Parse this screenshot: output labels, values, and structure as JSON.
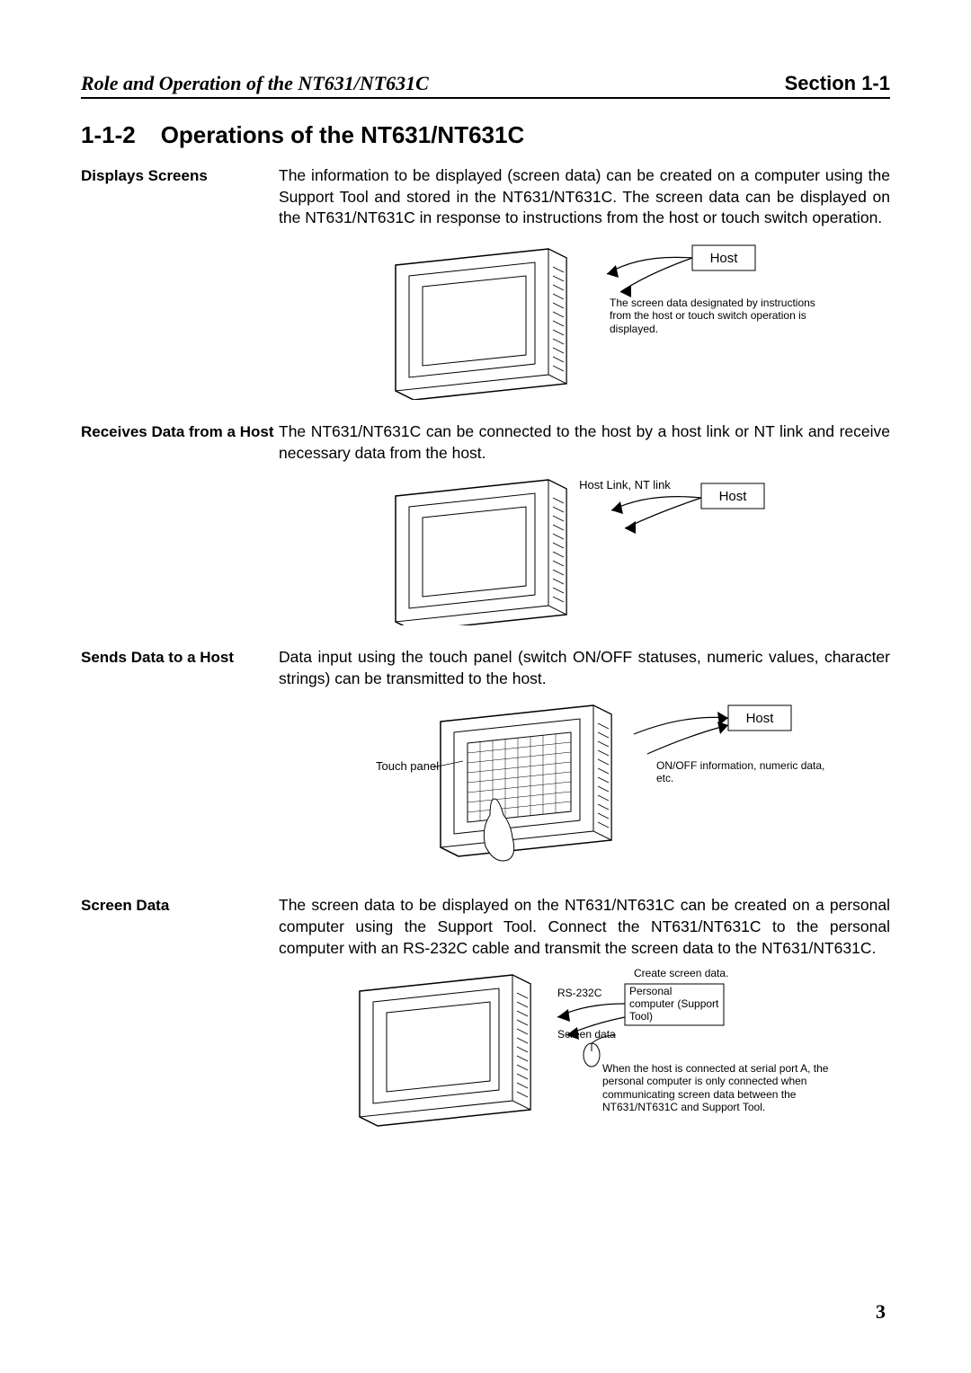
{
  "header": {
    "left": "Role and Operation of the NT631/NT631C",
    "right": "Section 1-1"
  },
  "section": {
    "number": "1-1-2",
    "title": "Operations of the NT631/NT631C"
  },
  "entries": [
    {
      "label": "Displays Screens",
      "body": "The information to be displayed (screen data) can be created on a computer using the Support Tool and stored in the NT631/NT631C. The screen data can be displayed on the NT631/NT631C in response to instructions from the host or touch switch operation.",
      "figure": {
        "hostLabel": "Host",
        "note": "The screen data designated by instructions from the host or touch switch operation is displayed."
      }
    },
    {
      "label": "Receives Data from a Host",
      "body": "The NT631/NT631C can be connected to the host by a host link or NT link and receive necessary data from the host.",
      "figure": {
        "linkLabel": "Host Link, NT link",
        "hostLabel": "Host"
      }
    },
    {
      "label": "Sends Data to a Host",
      "body": "Data input using the touch panel (switch ON/OFF statuses, numeric values, character strings) can be transmitted to the host.",
      "figure": {
        "touchLabel": "Touch panel",
        "hostLabel": "Host",
        "note": "ON/OFF information, numeric data, etc."
      }
    },
    {
      "label": "Screen Data",
      "body": "The screen data to be displayed on the NT631/NT631C can be created on a personal computer using the Support Tool. Connect the NT631/NT631C to the personal computer with an RS-232C cable and transmit the screen data to the NT631/NT631C.",
      "figure": {
        "createLabel": "Create screen data.",
        "portLabel": "RS-232C",
        "dataLabel": "Screen data",
        "pcLabel": "Personal computer (Support Tool)",
        "note": "When the host is connected at serial port A, the personal computer is only connected when communicating screen data between the NT631/NT631C and Support Tool."
      }
    }
  ],
  "pageNumber": "3"
}
